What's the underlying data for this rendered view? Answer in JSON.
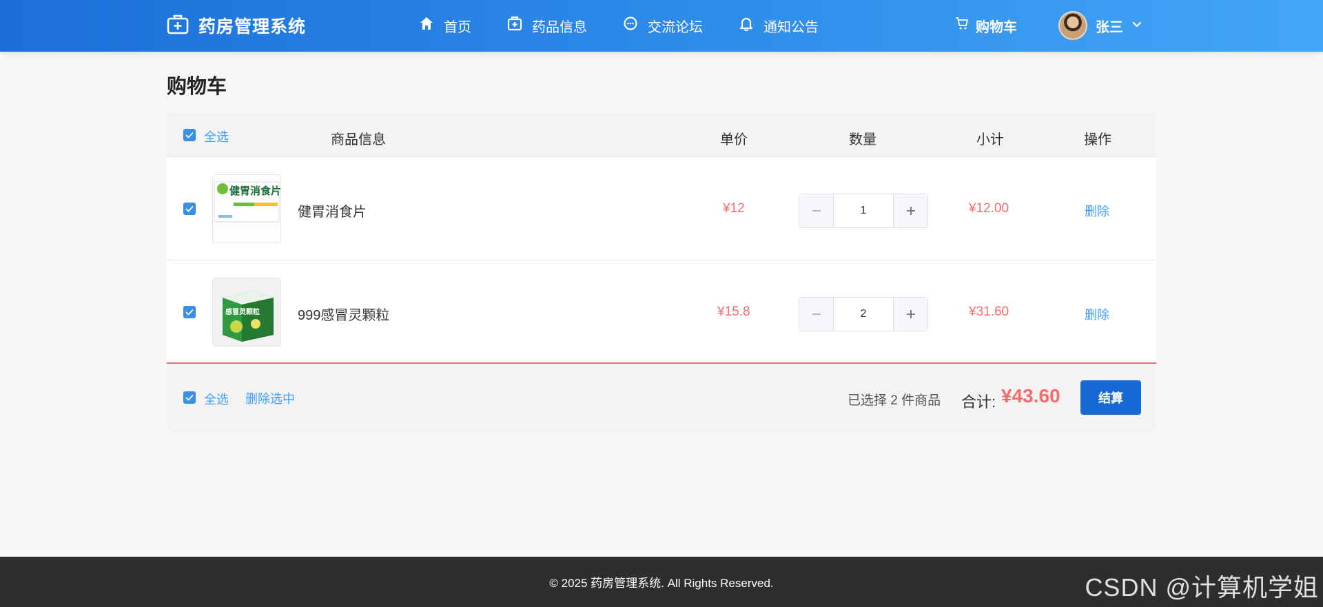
{
  "header": {
    "brand_title": "药房管理系统",
    "nav": [
      {
        "label": "首页",
        "icon": "home-icon"
      },
      {
        "label": "药品信息",
        "icon": "medicine-box-icon"
      },
      {
        "label": "交流论坛",
        "icon": "chat-icon"
      },
      {
        "label": "通知公告",
        "icon": "bell-icon"
      }
    ],
    "cart_label": "购物车",
    "user_name": "张三"
  },
  "page_title": "购物车",
  "table": {
    "headers": {
      "select_all": "全选",
      "product": "商品信息",
      "unit_price": "单价",
      "quantity": "数量",
      "subtotal": "小计",
      "action": "操作"
    },
    "rows": [
      {
        "checked": true,
        "name": "健胃消食片",
        "unit_price": "¥12",
        "quantity": "1",
        "subtotal": "¥12.00",
        "action": "删除",
        "image_text": "健胃消食片"
      },
      {
        "checked": true,
        "name": "999感冒灵颗粒",
        "unit_price": "¥15.8",
        "quantity": "2",
        "subtotal": "¥31.60",
        "action": "删除",
        "image_text": "感冒灵颗粒"
      }
    ]
  },
  "summary": {
    "select_all": "全选",
    "delete_selected": "删除选中",
    "selected_text": "已选择 2 件商品",
    "total_label": "合计:",
    "total_value": "¥43.60",
    "checkout_label": "结算"
  },
  "footer": {
    "copyright": "© 2025 药房管理系统. All Rights Reserved."
  },
  "watermark": "CSDN @计算机学姐",
  "colors": {
    "header_start": "#1a6fd8",
    "header_end": "#42a6f6",
    "accent_blue": "#409eff",
    "price_red": "#f56c6c",
    "checkout_blue": "#1769d4",
    "footer_bg": "#2e2e2e"
  }
}
